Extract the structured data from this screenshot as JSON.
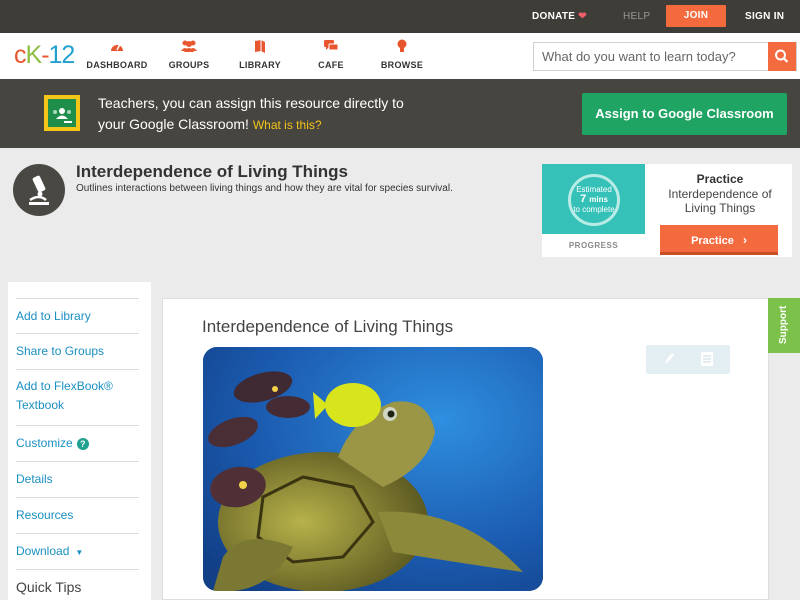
{
  "topbar": {
    "donate": "DONATE",
    "help": "HELP",
    "join": "JOIN",
    "signin": "SIGN IN"
  },
  "nav": {
    "logo": {
      "c": "c",
      "k": "K",
      "dash": "-",
      "n": "12"
    },
    "items": [
      {
        "label": "DASHBOARD",
        "icon": "dashboard-icon"
      },
      {
        "label": "GROUPS",
        "icon": "groups-icon"
      },
      {
        "label": "LIBRARY",
        "icon": "library-icon"
      },
      {
        "label": "CAFE",
        "icon": "cafe-icon"
      },
      {
        "label": "BROWSE",
        "icon": "browse-icon"
      }
    ],
    "search_placeholder": "What do you want to learn today?"
  },
  "banner": {
    "line1": "Teachers, you can assign this resource directly to",
    "line2": "your Google Classroom!",
    "what": "What is this?",
    "assign_button": "Assign to Google Classroom"
  },
  "concept": {
    "title": "Interdependence of Living Things",
    "description": "Outlines interactions between living things and how they are vital for species survival."
  },
  "practice": {
    "circle_top": "Estimated",
    "circle_mid": "7",
    "circle_mins": "mins",
    "circle_bottom": "to complete",
    "progress_label": "PROGRESS",
    "heading": "Practice",
    "subtitle": "Interdependence of Living Things",
    "button": "Practice"
  },
  "sidebar": {
    "items": [
      {
        "label": "Add to Library"
      },
      {
        "label": "Share to Groups"
      },
      {
        "label": "Add to FlexBook® Textbook"
      },
      {
        "label": "Customize"
      },
      {
        "label": "Details"
      },
      {
        "label": "Resources"
      },
      {
        "label": "Download"
      }
    ],
    "quick_tips": "Quick Tips"
  },
  "content": {
    "title": "Interdependence of Living Things",
    "support": "Support"
  },
  "colors": {
    "accent": "#f26a3d",
    "google_green": "#1fa463",
    "link_blue": "#1a8fc1",
    "support_green": "#7cc24a"
  }
}
